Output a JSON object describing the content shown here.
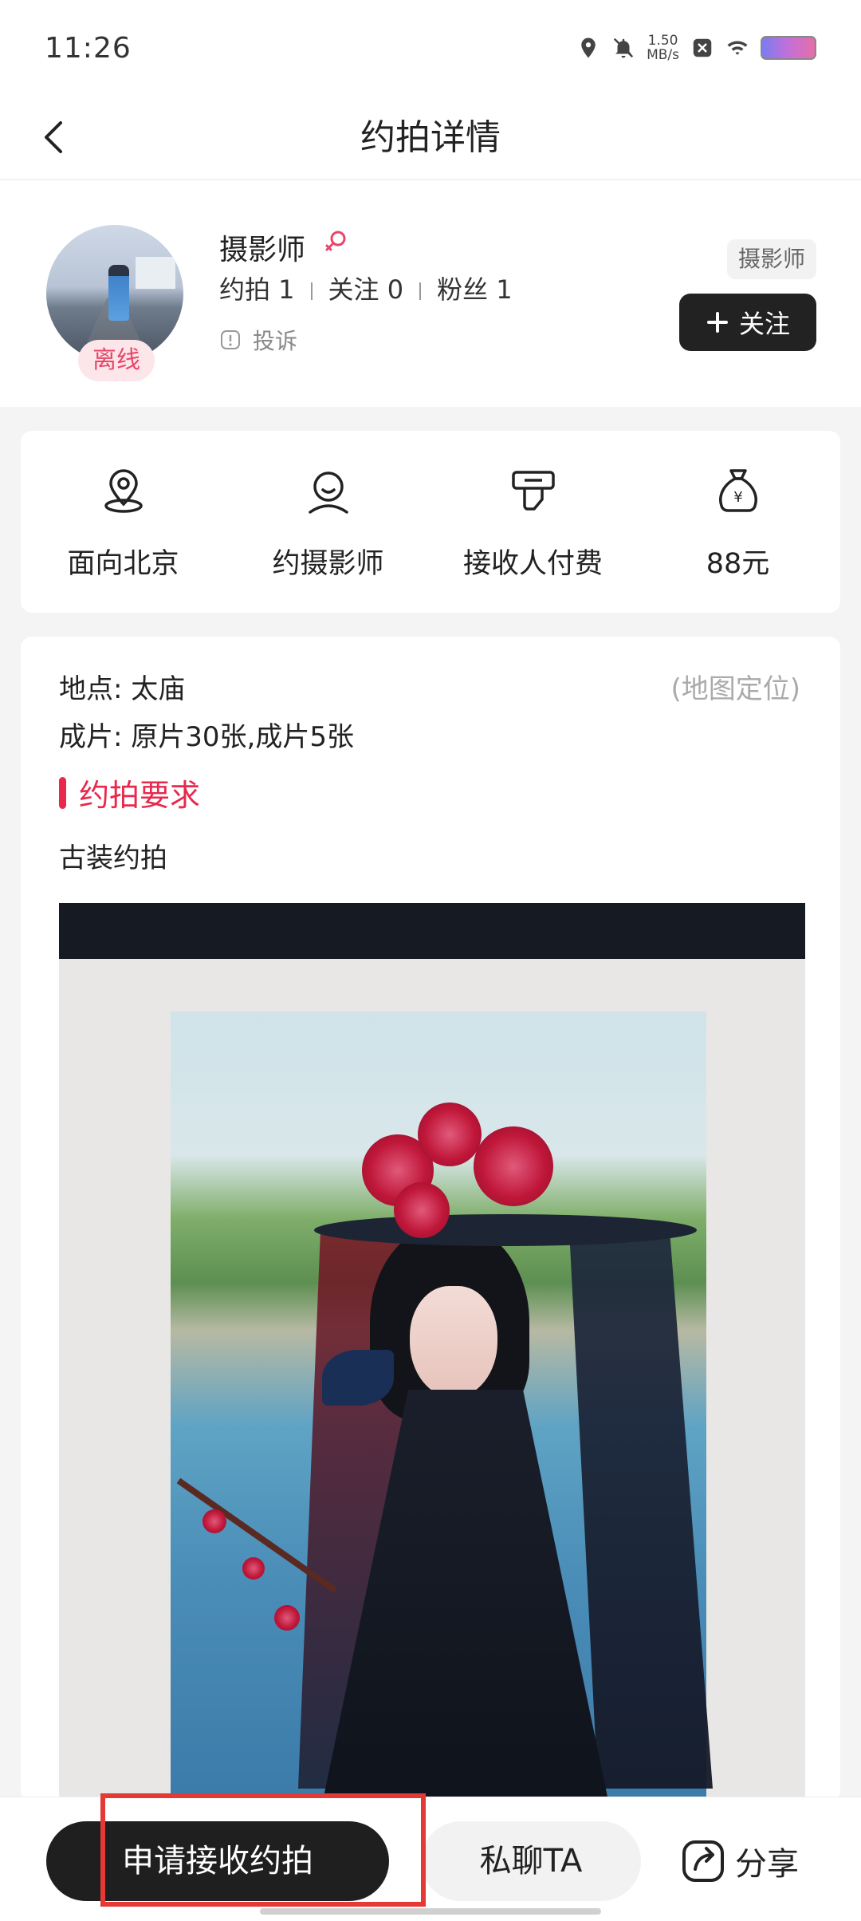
{
  "status_bar": {
    "time": "11:26",
    "net_speed_value": "1.50",
    "net_speed_unit": "MB/s"
  },
  "header": {
    "title": "约拍详情"
  },
  "profile": {
    "name": "摄影师",
    "offline_label": "离线",
    "stats": {
      "appointments": "约拍 1",
      "following": "关注 0",
      "fans": "粉丝 1"
    },
    "complaint_label": "投诉",
    "role_tag": "摄影师",
    "follow_label": "关注"
  },
  "info": {
    "items": [
      {
        "icon": "location-pin-icon",
        "label": "面向北京"
      },
      {
        "icon": "person-icon",
        "label": "约摄影师"
      },
      {
        "icon": "payment-hand-icon",
        "label": "接收人付费"
      },
      {
        "icon": "money-bag-icon",
        "label": "88元"
      }
    ]
  },
  "details": {
    "location": "地点: 太庙",
    "map_locate": "(地图定位)",
    "photos": "成片: 原片30张,成片5张",
    "section_title": "约拍要求",
    "requirement": "古装约拍"
  },
  "bottom": {
    "apply_label": "申请接收约拍",
    "chat_label": "私聊TA",
    "share_label": "分享"
  },
  "colors": {
    "accent": "#e8284c",
    "dark_button": "#1f1f1f",
    "highlight": "#e53935"
  }
}
